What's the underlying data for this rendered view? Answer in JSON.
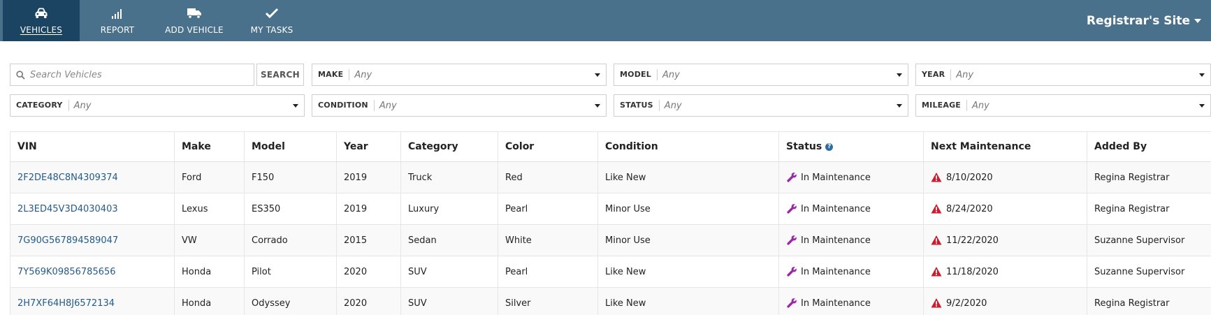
{
  "nav": {
    "items": [
      {
        "label": "VEHICLES",
        "icon": "car-icon",
        "active": true
      },
      {
        "label": "REPORT",
        "icon": "bar-chart-icon",
        "active": false
      },
      {
        "label": "ADD VEHICLE",
        "icon": "truck-icon",
        "active": false
      },
      {
        "label": "MY TASKS",
        "icon": "checkmark-icon",
        "active": false
      }
    ],
    "site_title": "Registrar's Site"
  },
  "filters": {
    "search": {
      "placeholder": "Search Vehicles",
      "button_label": "SEARCH"
    },
    "make": {
      "label": "MAKE",
      "value": "Any"
    },
    "model": {
      "label": "MODEL",
      "value": "Any"
    },
    "year": {
      "label": "YEAR",
      "value": "Any"
    },
    "category": {
      "label": "CATEGORY",
      "value": "Any"
    },
    "condition": {
      "label": "CONDITION",
      "value": "Any"
    },
    "status": {
      "label": "STATUS",
      "value": "Any"
    },
    "mileage": {
      "label": "MILEAGE",
      "value": "Any"
    }
  },
  "table": {
    "headers": {
      "vin": "VIN",
      "make": "Make",
      "model": "Model",
      "year": "Year",
      "category": "Category",
      "color": "Color",
      "condition": "Condition",
      "status": "Status",
      "next_maintenance": "Next Maintenance",
      "added_by": "Added By"
    },
    "rows": [
      {
        "vin": "2F2DE48C8N4309374",
        "make": "Ford",
        "model": "F150",
        "year": "2019",
        "category": "Truck",
        "color": "Red",
        "condition": "Like New",
        "status": "In Maintenance",
        "next_maintenance": "8/10/2020",
        "added_by": "Regina Registrar"
      },
      {
        "vin": "2L3ED45V3D4030403",
        "make": "Lexus",
        "model": "ES350",
        "year": "2019",
        "category": "Luxury",
        "color": "Pearl",
        "condition": "Minor Use",
        "status": "In Maintenance",
        "next_maintenance": "8/24/2020",
        "added_by": "Regina Registrar"
      },
      {
        "vin": "7G90G567894589047",
        "make": "VW",
        "model": "Corrado",
        "year": "2015",
        "category": "Sedan",
        "color": "White",
        "condition": "Minor Use",
        "status": "In Maintenance",
        "next_maintenance": "11/22/2020",
        "added_by": "Suzanne Supervisor"
      },
      {
        "vin": "7Y569K09856785656",
        "make": "Honda",
        "model": "Pilot",
        "year": "2020",
        "category": "SUV",
        "color": "Pearl",
        "condition": "Like New",
        "status": "In Maintenance",
        "next_maintenance": "11/18/2020",
        "added_by": "Suzanne Supervisor"
      },
      {
        "vin": "2H7XF64H8J6572134",
        "make": "Honda",
        "model": "Odyssey",
        "year": "2020",
        "category": "SUV",
        "color": "Silver",
        "condition": "Like New",
        "status": "In Maintenance",
        "next_maintenance": "9/2/2020",
        "added_by": "Regina Registrar"
      }
    ]
  },
  "colors": {
    "topbar": "#4a718c",
    "active_tab": "#1a4462",
    "link": "#245b8a",
    "status_icon": "#9b27a8",
    "warning_icon": "#d01b2c"
  }
}
